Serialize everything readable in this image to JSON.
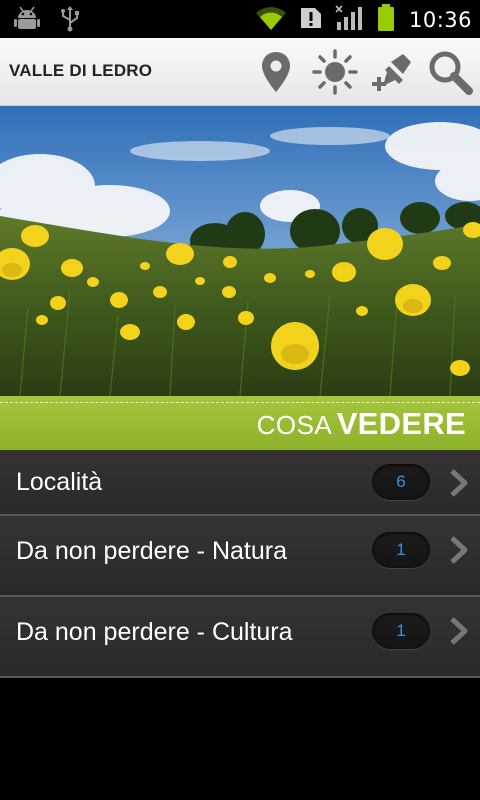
{
  "status_bar": {
    "time": "10:36",
    "icons": [
      "android-debug-icon",
      "usb-icon",
      "wifi-icon",
      "alert-icon",
      "signal-icon",
      "battery-icon"
    ]
  },
  "action_bar": {
    "title": "VALLE DI LEDRO",
    "actions": [
      "map-pin-icon",
      "weather-icon",
      "add-pin-icon",
      "search-icon"
    ]
  },
  "hero": {
    "image": "meadow-photo"
  },
  "section": {
    "title_light": "COSA",
    "title_bold": "VEDERE",
    "accent_color": "#9bbd35"
  },
  "list": {
    "items": [
      {
        "label": "Località",
        "count": "6"
      },
      {
        "label": "Da non perdere - Natura",
        "count": "1"
      },
      {
        "label": "Da non perdere - Cultura",
        "count": "1"
      }
    ]
  }
}
